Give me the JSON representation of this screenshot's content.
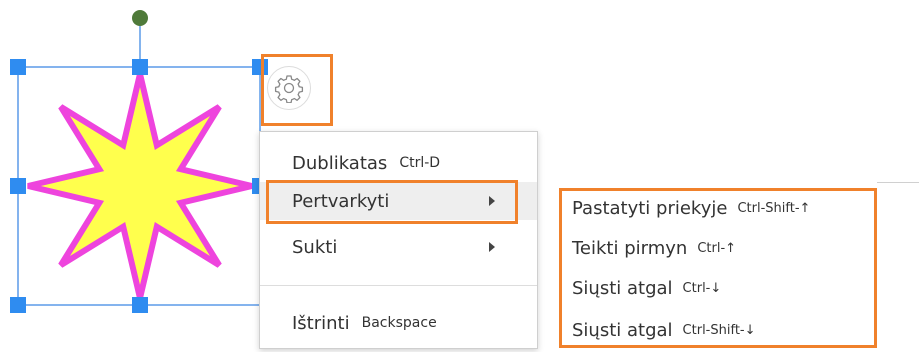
{
  "shape": {
    "fill_color": "#ffff4d",
    "stroke_color": "#ee44dd",
    "selection_color": "#5b9ae8",
    "handle_color": "#2f8cf0",
    "rotate_handle_color": "#4f7a3a"
  },
  "gear": {
    "icon": "gear-icon"
  },
  "highlight_color": "#f0812b",
  "context_menu": {
    "items": [
      {
        "label": "Dublikatas",
        "shortcut": "Ctrl-D",
        "has_submenu": false
      },
      {
        "label": "Pertvarkyti",
        "shortcut": "",
        "has_submenu": true
      },
      {
        "label": "Sukti",
        "shortcut": "",
        "has_submenu": true
      },
      {
        "label": "Ištrinti",
        "shortcut": "Backspace",
        "has_submenu": false
      }
    ]
  },
  "submenu": {
    "items": [
      {
        "label": "Pastatyti priekyje",
        "shortcut": "Ctrl-Shift-↑"
      },
      {
        "label": "Teikti pirmyn",
        "shortcut": "Ctrl-↑"
      },
      {
        "label": "Siųsti atgal",
        "shortcut": "Ctrl-↓"
      },
      {
        "label": "Siųsti atgal",
        "shortcut": "Ctrl-Shift-↓"
      }
    ]
  }
}
